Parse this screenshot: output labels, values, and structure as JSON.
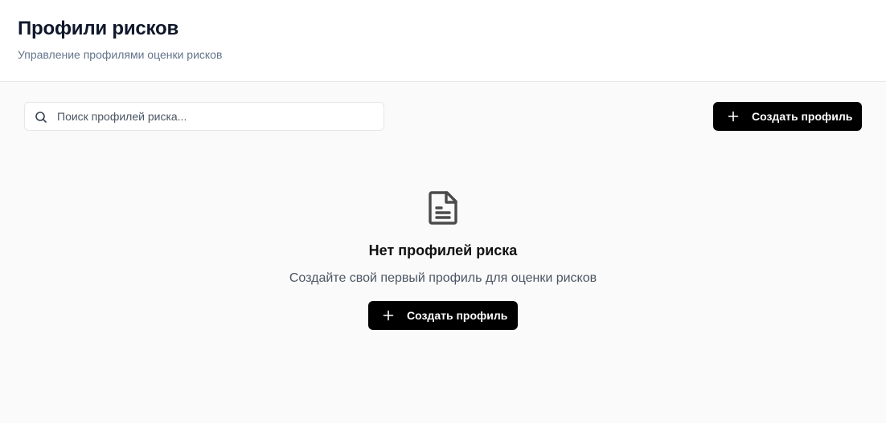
{
  "header": {
    "title": "Профили рисков",
    "subtitle": "Управление профилями оценки рисков"
  },
  "toolbar": {
    "search_placeholder": "Поиск профилей риска...",
    "search_value": "",
    "create_button_label": "Создать профиль"
  },
  "empty_state": {
    "icon": "document-icon",
    "title": "Нет профилей риска",
    "description": "Создайте свой первый профиль для оценки рисков",
    "create_button_label": "Создать профиль"
  },
  "colors": {
    "primary_button": "#000000",
    "subtitle": "#64748b",
    "page_background": "#fafafa"
  }
}
